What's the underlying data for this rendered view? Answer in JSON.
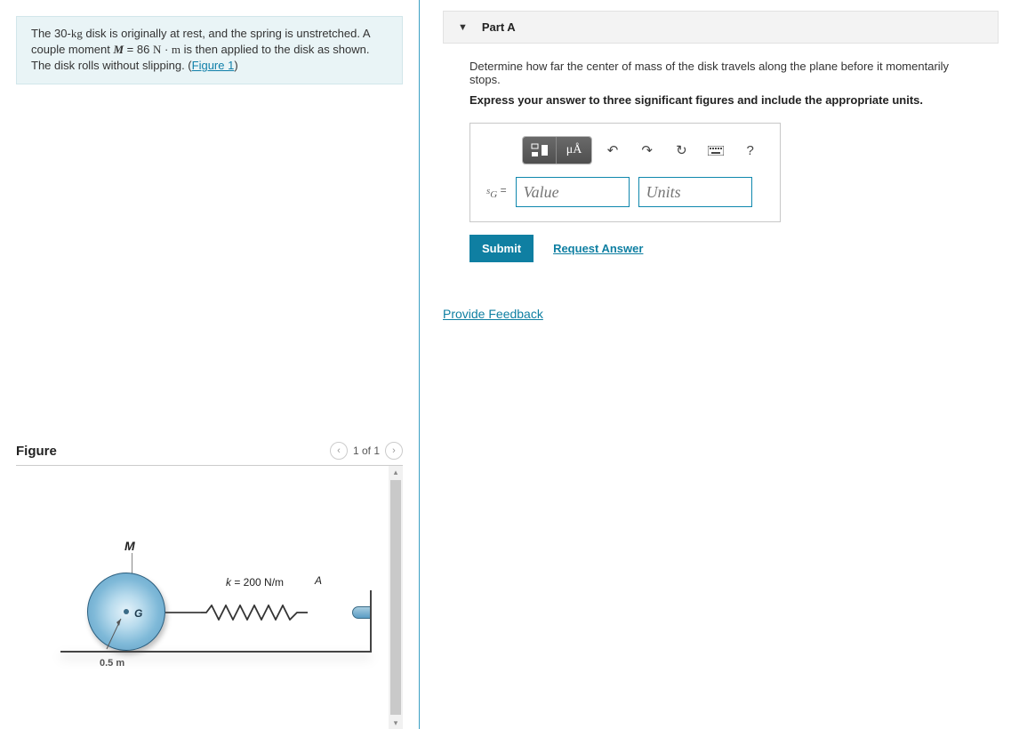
{
  "problem": {
    "text_parts": {
      "p1a": "The 30-",
      "p1b": "kg",
      "p1c": " disk is originally at rest, and the spring is unstretched. A couple moment ",
      "p2a": "M",
      "p2b": " = 86 ",
      "p2c": "N",
      "p2d": " · ",
      "p2e": "m",
      "p2f": " is then applied to the disk as shown. The disk rolls without slipping. (",
      "figlink": "Figure 1",
      "p2g": ")"
    }
  },
  "figure": {
    "title": "Figure",
    "counter": "1 of 1",
    "labels": {
      "M": "M",
      "G": "G",
      "radius": "0.5 m",
      "k": "k = 200 N/m",
      "A": "A"
    }
  },
  "partA": {
    "header": "Part A",
    "instruction1": "Determine how far the center of mass of the disk travels along the plane before it momentarily stops.",
    "instruction2": "Express your answer to three significant figures and include the appropriate units.",
    "eq_var": "s",
    "eq_sub": "G",
    "eq_equals": " =",
    "value_placeholder": "Value",
    "units_placeholder": "Units",
    "toolbar": {
      "templates": "▭",
      "mu_a": "μÅ",
      "undo": "↶",
      "redo": "↷",
      "reset": "↻",
      "keyboard": "⌨",
      "help": "?"
    },
    "submit": "Submit",
    "request": "Request Answer"
  },
  "feedback": "Provide Feedback"
}
